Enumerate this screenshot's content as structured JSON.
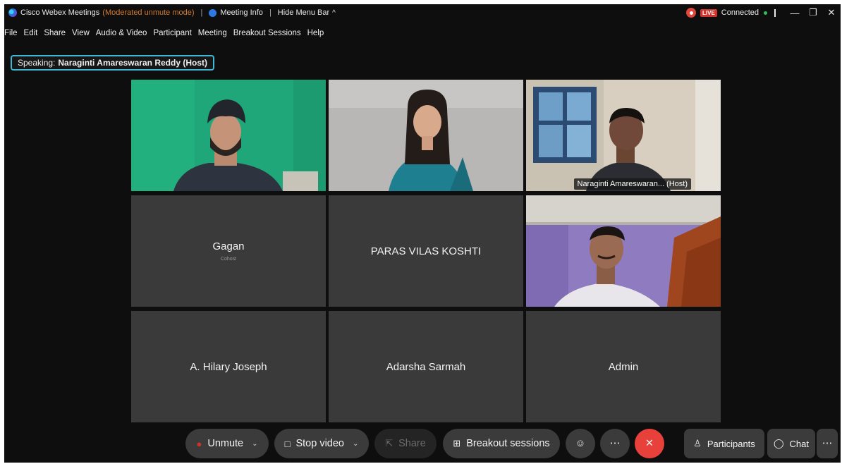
{
  "titlebar": {
    "app_title": "Cisco Webex Meetings",
    "mode": "(Moderated unmute mode)",
    "meeting_info": "Meeting Info",
    "hide_menu": "Hide Menu Bar",
    "live": "LIVE",
    "status": "Connected"
  },
  "menu": [
    "File",
    "Edit",
    "Share",
    "View",
    "Audio & Video",
    "Participant",
    "Meeting",
    "Breakout Sessions",
    "Help"
  ],
  "speaking": {
    "label": "Speaking:",
    "name": "Naraginti Amareswaran Reddy (Host)"
  },
  "tiles": [
    {
      "name": "",
      "sub": ""
    },
    {
      "name": "",
      "sub": ""
    },
    {
      "name": "Naraginti Amareswaran... (Host)",
      "sub": ""
    },
    {
      "name": "Gagan",
      "sub": "Cohost"
    },
    {
      "name": "PARAS VILAS KOSHTI",
      "sub": ""
    },
    {
      "name": "",
      "sub": ""
    },
    {
      "name": "A. Hilary Joseph",
      "sub": ""
    },
    {
      "name": "Adarsha Sarmah",
      "sub": ""
    },
    {
      "name": "Admin",
      "sub": ""
    }
  ],
  "controls": {
    "unmute": "Unmute",
    "stop_video": "Stop video",
    "share": "Share",
    "breakout": "Breakout sessions",
    "participants": "Participants",
    "chat": "Chat"
  },
  "colors": {
    "accent": "#3fb8d6",
    "end_call": "#e8403a",
    "tile_bg": "#3a3a3a"
  }
}
